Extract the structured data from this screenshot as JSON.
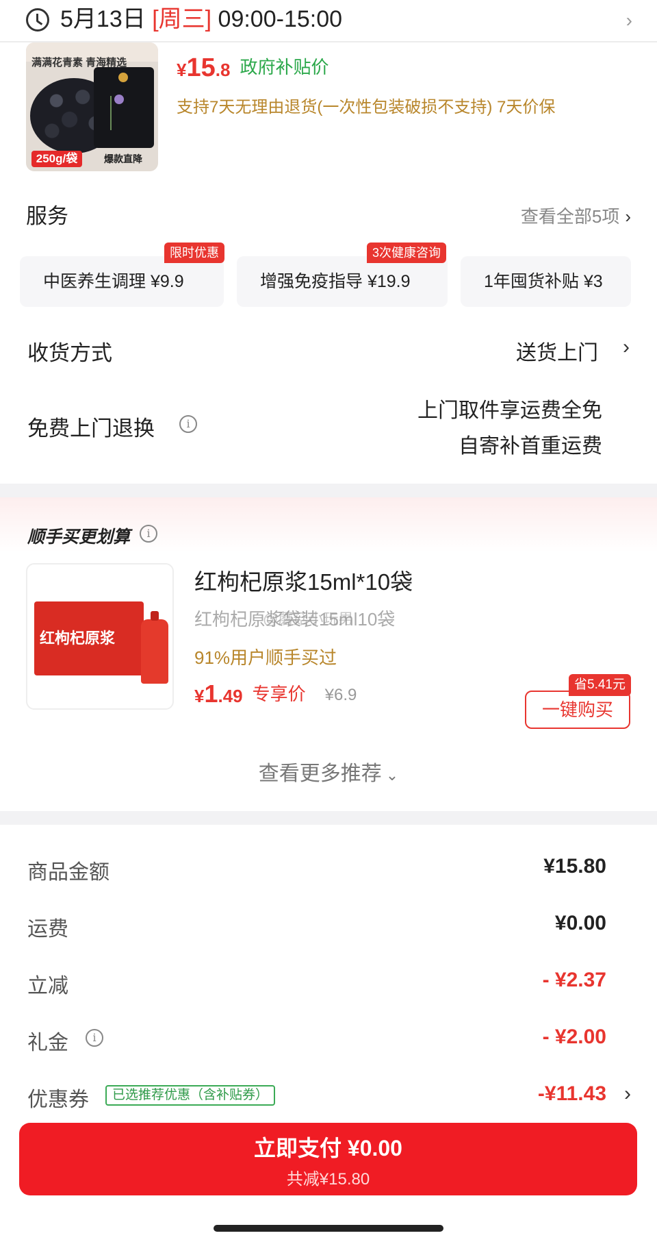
{
  "delivery": {
    "date": "5月13日",
    "weekday": "[周三]",
    "time_range": "09:00-15:00"
  },
  "product": {
    "image": {
      "tagline": "满满花青素  青海精选",
      "weight": "250g/袋",
      "promo": "爆款直降"
    },
    "currency": "¥",
    "price_int": "15",
    "price_dec": ".8",
    "price_label": "政府补贴价",
    "support_text": "支持7天无理由退货(一次性包装破损不支持) 7天价保"
  },
  "services": {
    "title": "服务",
    "see_all": "查看全部5项",
    "items": [
      {
        "label": "中医养生调理  ¥9.9",
        "badge": "限时优惠"
      },
      {
        "label": "增强免疫指导  ¥19.9",
        "badge": "3次健康咨询"
      },
      {
        "label": "1年囤货补贴  ¥3",
        "badge": ""
      }
    ]
  },
  "delivery_method": {
    "label": "收货方式",
    "value": "送货上门"
  },
  "returns": {
    "label": "免费上门退换",
    "line1": "上门取件享运费全免",
    "line2": "自寄补首重运费"
  },
  "bundle": {
    "title": "顺手买更划算",
    "item": {
      "image_name": "红枸杞原浆",
      "title": "红枸杞原浆15ml*10袋",
      "subtitle": "红枸杞原浆袋装15ml10袋",
      "watermark": "@蘑菇小玩男",
      "users": "91%用户顺手买过",
      "currency": "¥",
      "price_int": "1",
      "price_dec": ".49",
      "price_label": "专享价",
      "orig_price": "¥6.9",
      "save_badge": "省5.41元",
      "buy_label": "一键购买"
    },
    "more_label": "查看更多推荐"
  },
  "summary": {
    "rows": [
      {
        "label": "商品金额",
        "value": "¥15.80"
      },
      {
        "label": "运费",
        "value": "¥0.00"
      },
      {
        "label": "立减",
        "value": "- ¥2.37"
      },
      {
        "label": "礼金",
        "value": "- ¥2.00"
      },
      {
        "label": "优惠券",
        "value": "-¥11.43"
      }
    ],
    "coupon_tag": "已选推荐优惠（含补贴券）"
  },
  "footer": {
    "pay_label": "立即支付 ¥0.00",
    "saved_label": "共减¥15.80"
  },
  "colors": {
    "accent_red": "#e8352f",
    "pay_red": "#f01c24",
    "green": "#2ba84a",
    "gold": "#b8862b"
  }
}
